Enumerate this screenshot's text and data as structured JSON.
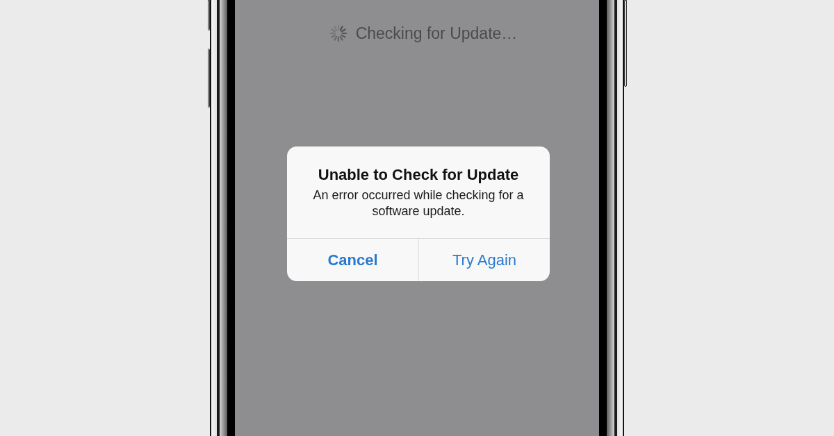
{
  "status": {
    "text": "Checking for Update…",
    "loading": true
  },
  "alert": {
    "title": "Unable to Check for Update",
    "message": "An error occurred while checking for a software update.",
    "buttons": [
      {
        "label": "Cancel",
        "preferred": true
      },
      {
        "label": "Try Again",
        "preferred": false
      }
    ]
  }
}
